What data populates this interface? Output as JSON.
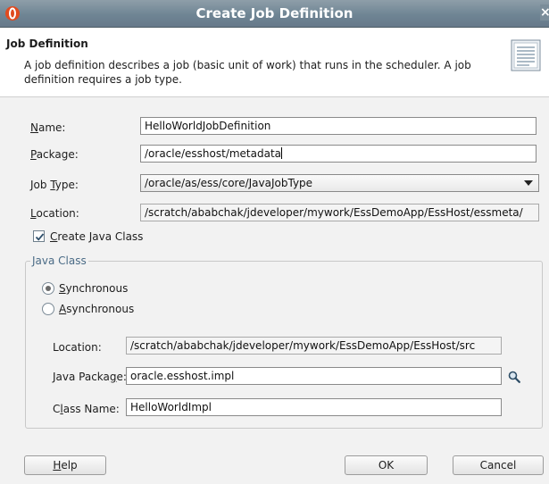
{
  "window": {
    "title": "Create Job Definition"
  },
  "header": {
    "title": "Job Definition",
    "description": "A job definition describes a job (basic unit of work) that runs in the scheduler.  A job definition requires a job type."
  },
  "form": {
    "name": {
      "label_mnemonic": "N",
      "label_rest": "ame:",
      "value": "HelloWorldJobDefinition"
    },
    "package": {
      "label_mnemonic": "P",
      "label_rest": "ackage:",
      "value": "/oracle/esshost/metadata"
    },
    "job_type": {
      "label_prefix": "Job ",
      "label_mnemonic": "T",
      "label_rest": "ype:",
      "value": "/oracle/as/ess/core/JavaJobType"
    },
    "location": {
      "label_mnemonic": "L",
      "label_rest": "ocation:",
      "value": "/scratch/ababchak/jdeveloper/mywork/EssDemoApp/EssHost/essmeta/"
    },
    "create_java_class": {
      "label_mnemonic": "C",
      "label_rest": "reate Java Class",
      "checked": true
    }
  },
  "java_class": {
    "legend": "Java Class",
    "synchronous": {
      "label_mnemonic": "S",
      "label_rest": "ynchronous",
      "selected": true
    },
    "asynchronous": {
      "label_mnemonic": "A",
      "label_rest": "synchronous",
      "selected": false
    },
    "location": {
      "label": "Location:",
      "value": "/scratch/ababchak/jdeveloper/mywork/EssDemoApp/EssHost/src"
    },
    "java_package": {
      "label_prefix": "Java Packa",
      "label_mnemonic": "g",
      "label_rest": "e:",
      "value": "oracle.esshost.impl"
    },
    "class_name": {
      "label_prefix": "C",
      "label_mnemonic": "l",
      "label_rest": "ass Name:",
      "value": "HelloWorldImpl"
    }
  },
  "buttons": {
    "help_mnemonic": "H",
    "help_rest": "elp",
    "ok": "OK",
    "cancel": "Cancel"
  },
  "icons": {
    "app": "oracle-logo-icon",
    "close": "close-icon",
    "header": "document-icon",
    "browse": "search-icon",
    "check": "checkmark-icon"
  },
  "colors": {
    "titlebar": "#6f8594",
    "accent": "#4a6b86",
    "dialog_bg": "#f2f2f2"
  }
}
